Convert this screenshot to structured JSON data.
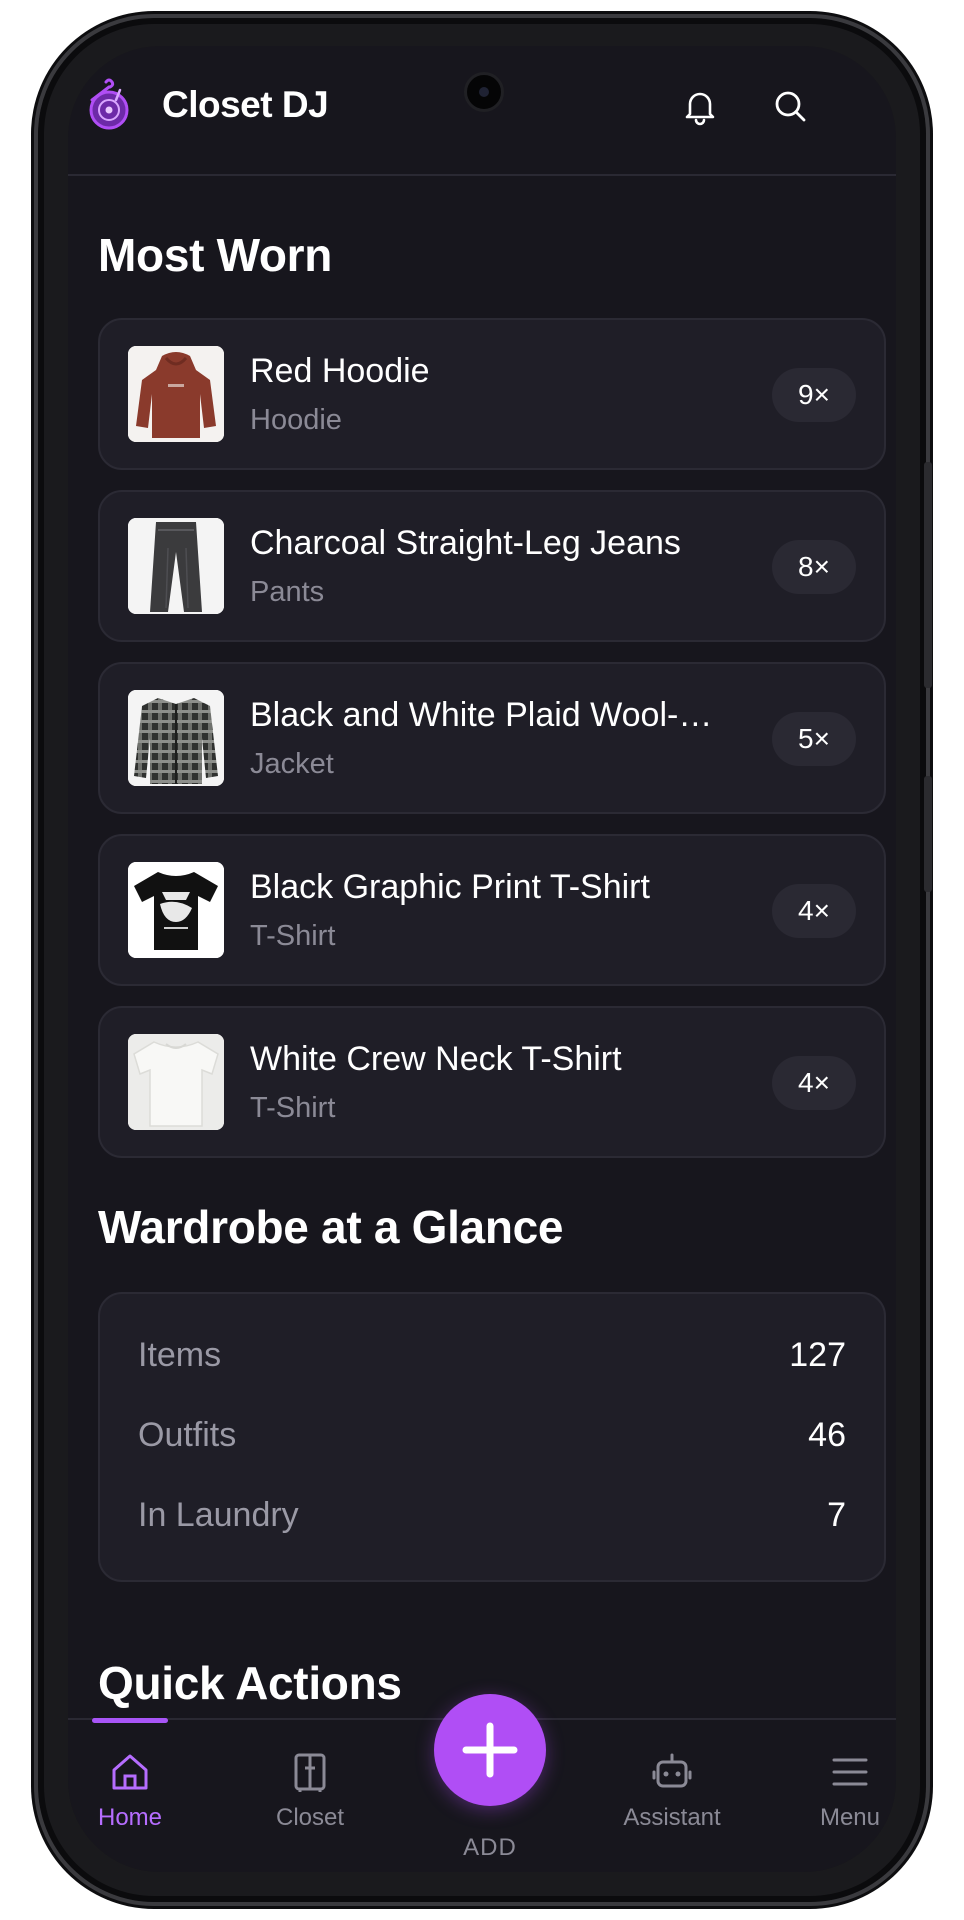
{
  "app": {
    "title": "Closet DJ"
  },
  "header": {
    "icons": [
      "bell-icon",
      "search-icon"
    ]
  },
  "most_worn": {
    "title": "Most Worn",
    "items": [
      {
        "name": "Red Hoodie",
        "category": "Hoodie",
        "count": "9×",
        "thumb": "red-hoodie"
      },
      {
        "name": "Charcoal Straight-Leg Jeans",
        "category": "Pants",
        "count": "8×",
        "thumb": "charcoal-jeans"
      },
      {
        "name": "Black and White Plaid Wool-…",
        "category": "Jacket",
        "count": "5×",
        "thumb": "plaid-jacket"
      },
      {
        "name": "Black Graphic Print T-Shirt",
        "category": "T-Shirt",
        "count": "4×",
        "thumb": "black-graphic-tee"
      },
      {
        "name": "White Crew Neck T-Shirt",
        "category": "T-Shirt",
        "count": "4×",
        "thumb": "white-tee"
      }
    ]
  },
  "glance": {
    "title": "Wardrobe at a Glance",
    "stats": [
      {
        "label": "Items",
        "value": "127"
      },
      {
        "label": "Outfits",
        "value": "46"
      },
      {
        "label": "In Laundry",
        "value": "7"
      }
    ]
  },
  "quick_actions": {
    "title": "Quick Actions"
  },
  "nav": {
    "items": [
      {
        "label": "Home",
        "icon": "home-icon",
        "active": true
      },
      {
        "label": "Closet",
        "icon": "closet-icon",
        "active": false
      },
      {
        "label": "ADD",
        "icon": "plus-icon",
        "active": false
      },
      {
        "label": "Assistant",
        "icon": "robot-icon",
        "active": false
      },
      {
        "label": "Menu",
        "icon": "menu-icon",
        "active": false
      }
    ]
  },
  "colors": {
    "accent": "#b04ef5",
    "background": "#17161d",
    "card": "#1f1e27"
  }
}
